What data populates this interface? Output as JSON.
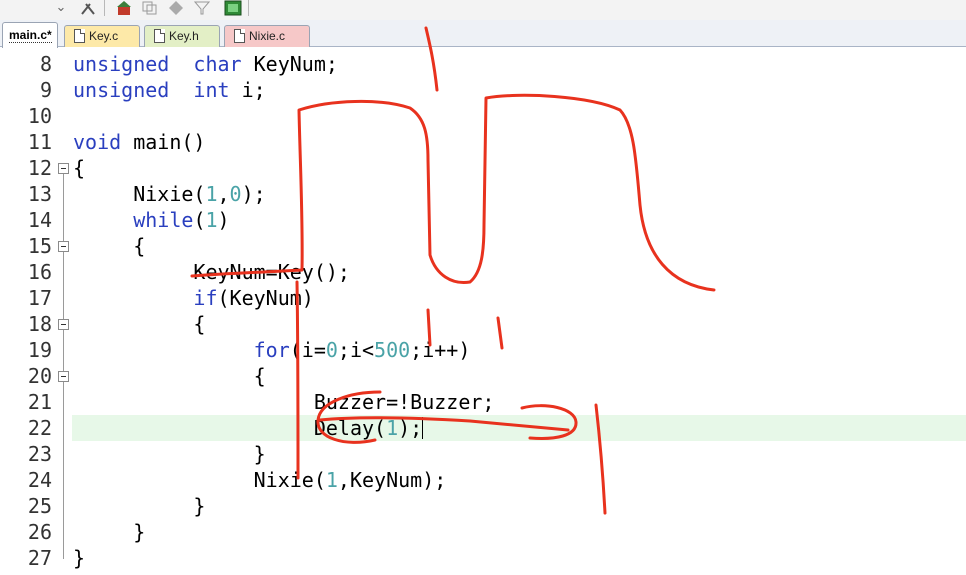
{
  "tabs": [
    {
      "label": "main.c*",
      "active": true
    },
    {
      "label": "Key.c",
      "color": "#fde9a8"
    },
    {
      "label": "Key.h",
      "color": "#e3efc6"
    },
    {
      "label": "Nixie.c",
      "color": "#f6c8c8"
    }
  ],
  "editor": {
    "current_line": 22,
    "lines": [
      {
        "n": "8",
        "tokens": [
          [
            "kw",
            "unsigned"
          ],
          [
            "",
            "  "
          ],
          [
            "kw",
            "char"
          ],
          [
            "",
            " KeyNum;"
          ]
        ]
      },
      {
        "n": "9",
        "tokens": [
          [
            "kw",
            "unsigned"
          ],
          [
            "",
            "  "
          ],
          [
            "kw",
            "int"
          ],
          [
            "",
            " i;"
          ]
        ]
      },
      {
        "n": "10",
        "tokens": []
      },
      {
        "n": "11",
        "tokens": [
          [
            "kw",
            "void"
          ],
          [
            "",
            " main()"
          ]
        ]
      },
      {
        "n": "12",
        "tokens": [
          [
            "",
            "{"
          ]
        ]
      },
      {
        "n": "13",
        "tokens": [
          [
            "",
            "     Nixie("
          ],
          [
            "num",
            "1"
          ],
          [
            "",
            ","
          ],
          [
            "num",
            "0"
          ],
          [
            "",
            ");"
          ]
        ]
      },
      {
        "n": "14",
        "tokens": [
          [
            "",
            "     "
          ],
          [
            "kw",
            "while"
          ],
          [
            "",
            "("
          ],
          [
            "num",
            "1"
          ],
          [
            "",
            ")"
          ]
        ]
      },
      {
        "n": "15",
        "tokens": [
          [
            "",
            "     {"
          ]
        ]
      },
      {
        "n": "16",
        "tokens": [
          [
            "",
            "          KeyNum=Key();"
          ]
        ]
      },
      {
        "n": "17",
        "tokens": [
          [
            "",
            "          "
          ],
          [
            "kw",
            "if"
          ],
          [
            "",
            "(KeyNum)"
          ]
        ]
      },
      {
        "n": "18",
        "tokens": [
          [
            "",
            "          {"
          ]
        ]
      },
      {
        "n": "19",
        "tokens": [
          [
            "",
            "               "
          ],
          [
            "kw",
            "for"
          ],
          [
            "",
            "(i="
          ],
          [
            "num",
            "0"
          ],
          [
            "",
            ";i<"
          ],
          [
            "num",
            "500"
          ],
          [
            "",
            ";i++)"
          ]
        ]
      },
      {
        "n": "20",
        "tokens": [
          [
            "",
            "               {"
          ]
        ]
      },
      {
        "n": "21",
        "tokens": [
          [
            "",
            "                    Buzzer=!Buzzer;"
          ]
        ]
      },
      {
        "n": "22",
        "tokens": [
          [
            "",
            "                    Delay("
          ],
          [
            "num",
            "1"
          ],
          [
            "",
            ");"
          ]
        ]
      },
      {
        "n": "23",
        "tokens": [
          [
            "",
            "               }"
          ]
        ]
      },
      {
        "n": "24",
        "tokens": [
          [
            "",
            "               Nixie("
          ],
          [
            "num",
            "1"
          ],
          [
            "",
            ",KeyNum);"
          ]
        ]
      },
      {
        "n": "25",
        "tokens": [
          [
            "",
            "          }"
          ]
        ]
      },
      {
        "n": "26",
        "tokens": [
          [
            "",
            "     }"
          ]
        ]
      },
      {
        "n": "27",
        "tokens": [
          [
            "",
            "}"
          ]
        ]
      }
    ]
  },
  "colors": {
    "keyword": "#2a3fbf",
    "number": "#4aa3a7",
    "current_line_bg": "#e7f8e8",
    "annotation_ink": "#e8321e"
  }
}
